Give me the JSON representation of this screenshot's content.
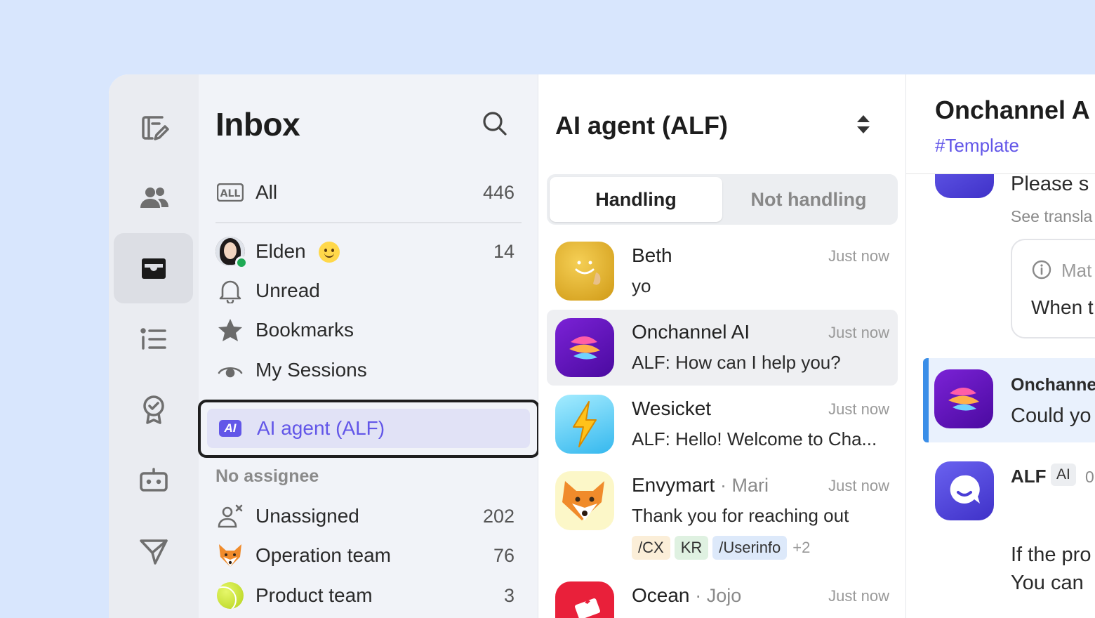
{
  "rail": {
    "items": [
      {
        "name": "compose",
        "icon": "compose-icon"
      },
      {
        "name": "contacts",
        "icon": "people-icon"
      },
      {
        "name": "inbox",
        "icon": "inbox-icon",
        "active": true
      },
      {
        "name": "list",
        "icon": "list-icon"
      },
      {
        "name": "badge",
        "icon": "badge-check-icon"
      },
      {
        "name": "bot",
        "icon": "bot-icon"
      },
      {
        "name": "send",
        "icon": "send-icon"
      }
    ]
  },
  "sidebar": {
    "title": "Inbox",
    "all": {
      "label": "All",
      "count": "446"
    },
    "items": [
      {
        "label": "Elden",
        "count": "14"
      },
      {
        "label": "Unread",
        "count": ""
      },
      {
        "label": "Bookmarks",
        "count": ""
      },
      {
        "label": "My Sessions",
        "count": ""
      }
    ],
    "selected": {
      "label": "AI agent (ALF)",
      "badge": "AI"
    },
    "section_label": "No assignee",
    "no_assignee": [
      {
        "label": "Unassigned",
        "count": "202"
      },
      {
        "label": "Operation team",
        "count": "76"
      },
      {
        "label": "Product team",
        "count": "3"
      }
    ]
  },
  "list": {
    "title": "AI agent (ALF)",
    "tabs": [
      "Handling",
      "Not handling"
    ],
    "active_tab": "Handling",
    "conversations": [
      {
        "name": "Beth",
        "sub": "",
        "time": "Just now",
        "message": "yo"
      },
      {
        "name": "Onchannel AI",
        "sub": "",
        "time": "Just now",
        "message": "ALF: How can I help you?"
      },
      {
        "name": "Wesicket",
        "sub": "",
        "time": "Just now",
        "message": "ALF: Hello! Welcome to Cha..."
      },
      {
        "name": "Envymart",
        "sub": "· Mari",
        "time": "Just now",
        "message": "Thank you for reaching out",
        "tags": [
          "/CX",
          "KR",
          "/Userinfo"
        ],
        "more": "+2"
      },
      {
        "name": "Ocean",
        "sub": "· Jojo",
        "time": "Just now",
        "message": ""
      }
    ]
  },
  "chat": {
    "title": "Onchannel  A",
    "tag": "#Template",
    "lines": {
      "l1": "Please s",
      "l2": "See transla",
      "notice_title": "Mat",
      "notice_body": "When t",
      "hl_name": "Onchanne",
      "hl_text": "Could yo",
      "alf_name": "ALF",
      "alf_badge": "AI",
      "alf_time": "0",
      "p1": "If the pro",
      "p2": "You can"
    }
  },
  "colors": {
    "background": "#d8e6fd",
    "accent": "#6256e8",
    "online": "#1faa55",
    "highlight_bar": "#3a8ee8"
  }
}
